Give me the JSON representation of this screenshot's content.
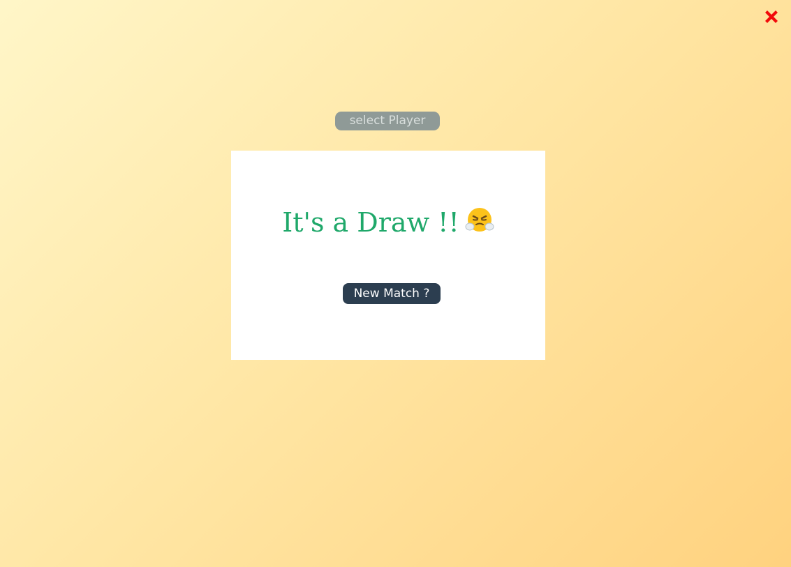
{
  "header": {
    "close_icon": "close-x-icon",
    "close_color": "#f20a0a"
  },
  "player_select": {
    "label": "select Player"
  },
  "result_modal": {
    "message": "It's a Draw !!",
    "emoji_icon": "face-with-steam-from-nose-icon",
    "new_match_label": "New Match ?"
  },
  "colors": {
    "background_start": "#fff6c8",
    "background_end": "#ffd27f",
    "message_color": "#1fa86a",
    "button_color": "#2c3e50",
    "pill_color": "#8f9a97"
  }
}
